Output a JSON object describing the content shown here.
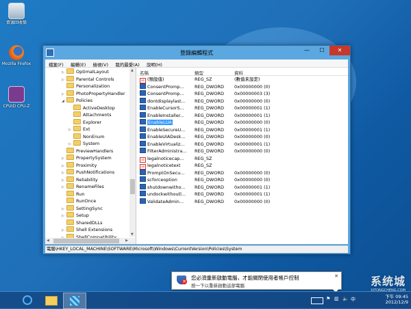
{
  "desktop": {
    "icons": [
      {
        "label": "資源回收筒",
        "icon": "recycle-bin-icon"
      },
      {
        "label": "Mozilla Firefox",
        "icon": "firefox-icon"
      },
      {
        "label": "CPUID CPU-Z",
        "icon": "cpuz-icon"
      }
    ]
  },
  "window": {
    "title": "登錄編輯程式",
    "buttons": {
      "minimize": "—",
      "maximize": "☐",
      "close": "✕"
    },
    "menu": [
      "檔案(F)",
      "編輯(E)",
      "檢視(V)",
      "我的最愛(A)",
      "說明(H)"
    ],
    "tree": [
      {
        "label": "OptimalLayout",
        "level": 0,
        "arrow": "▷"
      },
      {
        "label": "Parental Controls",
        "level": 0,
        "arrow": "▷"
      },
      {
        "label": "Personalization",
        "level": 0,
        "arrow": ""
      },
      {
        "label": "PhotoPropertyHandler",
        "level": 0,
        "arrow": "▷"
      },
      {
        "label": "Policies",
        "level": 0,
        "arrow": "◢"
      },
      {
        "label": "ActiveDesktop",
        "level": 1,
        "arrow": ""
      },
      {
        "label": "Attachments",
        "level": 1,
        "arrow": ""
      },
      {
        "label": "Explorer",
        "level": 1,
        "arrow": ""
      },
      {
        "label": "Ext",
        "level": 1,
        "arrow": "▷"
      },
      {
        "label": "NonEnum",
        "level": 1,
        "arrow": ""
      },
      {
        "label": "System",
        "level": 1,
        "arrow": "▷"
      },
      {
        "label": "PreviewHandlers",
        "level": 0,
        "arrow": ""
      },
      {
        "label": "PropertySystem",
        "level": 0,
        "arrow": "▷"
      },
      {
        "label": "Proximity",
        "level": 0,
        "arrow": "▷"
      },
      {
        "label": "PushNotifications",
        "level": 0,
        "arrow": "▷"
      },
      {
        "label": "Reliability",
        "level": 0,
        "arrow": "▷"
      },
      {
        "label": "RenameFiles",
        "level": 0,
        "arrow": "▷"
      },
      {
        "label": "Run",
        "level": 0,
        "arrow": ""
      },
      {
        "label": "RunOnce",
        "level": 0,
        "arrow": ""
      },
      {
        "label": "SettingSync",
        "level": 0,
        "arrow": "▷"
      },
      {
        "label": "Setup",
        "level": 0,
        "arrow": "▷"
      },
      {
        "label": "SharedDLLs",
        "level": 0,
        "arrow": ""
      },
      {
        "label": "Shell Extensions",
        "level": 0,
        "arrow": "▷"
      },
      {
        "label": "ShellCompatibility",
        "level": 0,
        "arrow": "▷"
      }
    ],
    "columns": {
      "name": "名稱",
      "type": "類型",
      "data": "資料"
    },
    "values": [
      {
        "name": "(預設值)",
        "type": "REG_SZ",
        "data": "(數值未設定)",
        "icon": "sz"
      },
      {
        "name": "ConsentPromp...",
        "type": "REG_DWORD",
        "data": "0x00000000 (0)",
        "icon": "dword"
      },
      {
        "name": "ConsentPromp...",
        "type": "REG_DWORD",
        "data": "0x00000003 (3)",
        "icon": "dword"
      },
      {
        "name": "dontdisplaylast...",
        "type": "REG_DWORD",
        "data": "0x00000000 (0)",
        "icon": "dword"
      },
      {
        "name": "EnableCursorS...",
        "type": "REG_DWORD",
        "data": "0x00000001 (1)",
        "icon": "dword"
      },
      {
        "name": "EnableInstaller...",
        "type": "REG_DWORD",
        "data": "0x00000001 (1)",
        "icon": "dword"
      },
      {
        "name": "EnableLUA",
        "type": "REG_DWORD",
        "data": "0x00000000 (0)",
        "icon": "dword",
        "selected": true
      },
      {
        "name": "EnableSecureU...",
        "type": "REG_DWORD",
        "data": "0x00000001 (1)",
        "icon": "dword"
      },
      {
        "name": "EnableUIADesk...",
        "type": "REG_DWORD",
        "data": "0x00000000 (0)",
        "icon": "dword"
      },
      {
        "name": "EnableVirtualiz...",
        "type": "REG_DWORD",
        "data": "0x00000001 (1)",
        "icon": "dword"
      },
      {
        "name": "FilterAdministra...",
        "type": "REG_DWORD",
        "data": "0x00000000 (0)",
        "icon": "dword"
      },
      {
        "name": "legalnoticecap...",
        "type": "REG_SZ",
        "data": "",
        "icon": "sz"
      },
      {
        "name": "legalnoticetext",
        "type": "REG_SZ",
        "data": "",
        "icon": "sz"
      },
      {
        "name": "PromptOnSecu...",
        "type": "REG_DWORD",
        "data": "0x00000000 (0)",
        "icon": "dword"
      },
      {
        "name": "scforceoption",
        "type": "REG_DWORD",
        "data": "0x00000000 (0)",
        "icon": "dword"
      },
      {
        "name": "shutdownwitho...",
        "type": "REG_DWORD",
        "data": "0x00000001 (1)",
        "icon": "dword"
      },
      {
        "name": "undockwithoutl...",
        "type": "REG_DWORD",
        "data": "0x00000001 (1)",
        "icon": "dword"
      },
      {
        "name": "ValidateAdmin...",
        "type": "REG_DWORD",
        "data": "0x00000000 (0)",
        "icon": "dword"
      }
    ],
    "status_path": "電腦\\HKEY_LOCAL_MACHINE\\SOFTWARE\\Microsoft\\Windows\\CurrentVersion\\Policies\\System"
  },
  "notification": {
    "line1": "您必須重新啟動電腦，才能關閉使用者帳戶控制",
    "line2": "按一下以重新啟動這部電腦",
    "close": "✕"
  },
  "taskbar": {
    "apps": [
      {
        "icon": "internet-explorer-icon",
        "active": false
      },
      {
        "icon": "file-explorer-icon",
        "active": false
      },
      {
        "icon": "registry-editor-icon",
        "active": true
      }
    ],
    "tray": {
      "ime": "中",
      "time": "下午 09:45",
      "date": "2012/12/9"
    }
  },
  "watermark": {
    "text": "系统城",
    "sub": "XITONGCHENG.COM"
  }
}
